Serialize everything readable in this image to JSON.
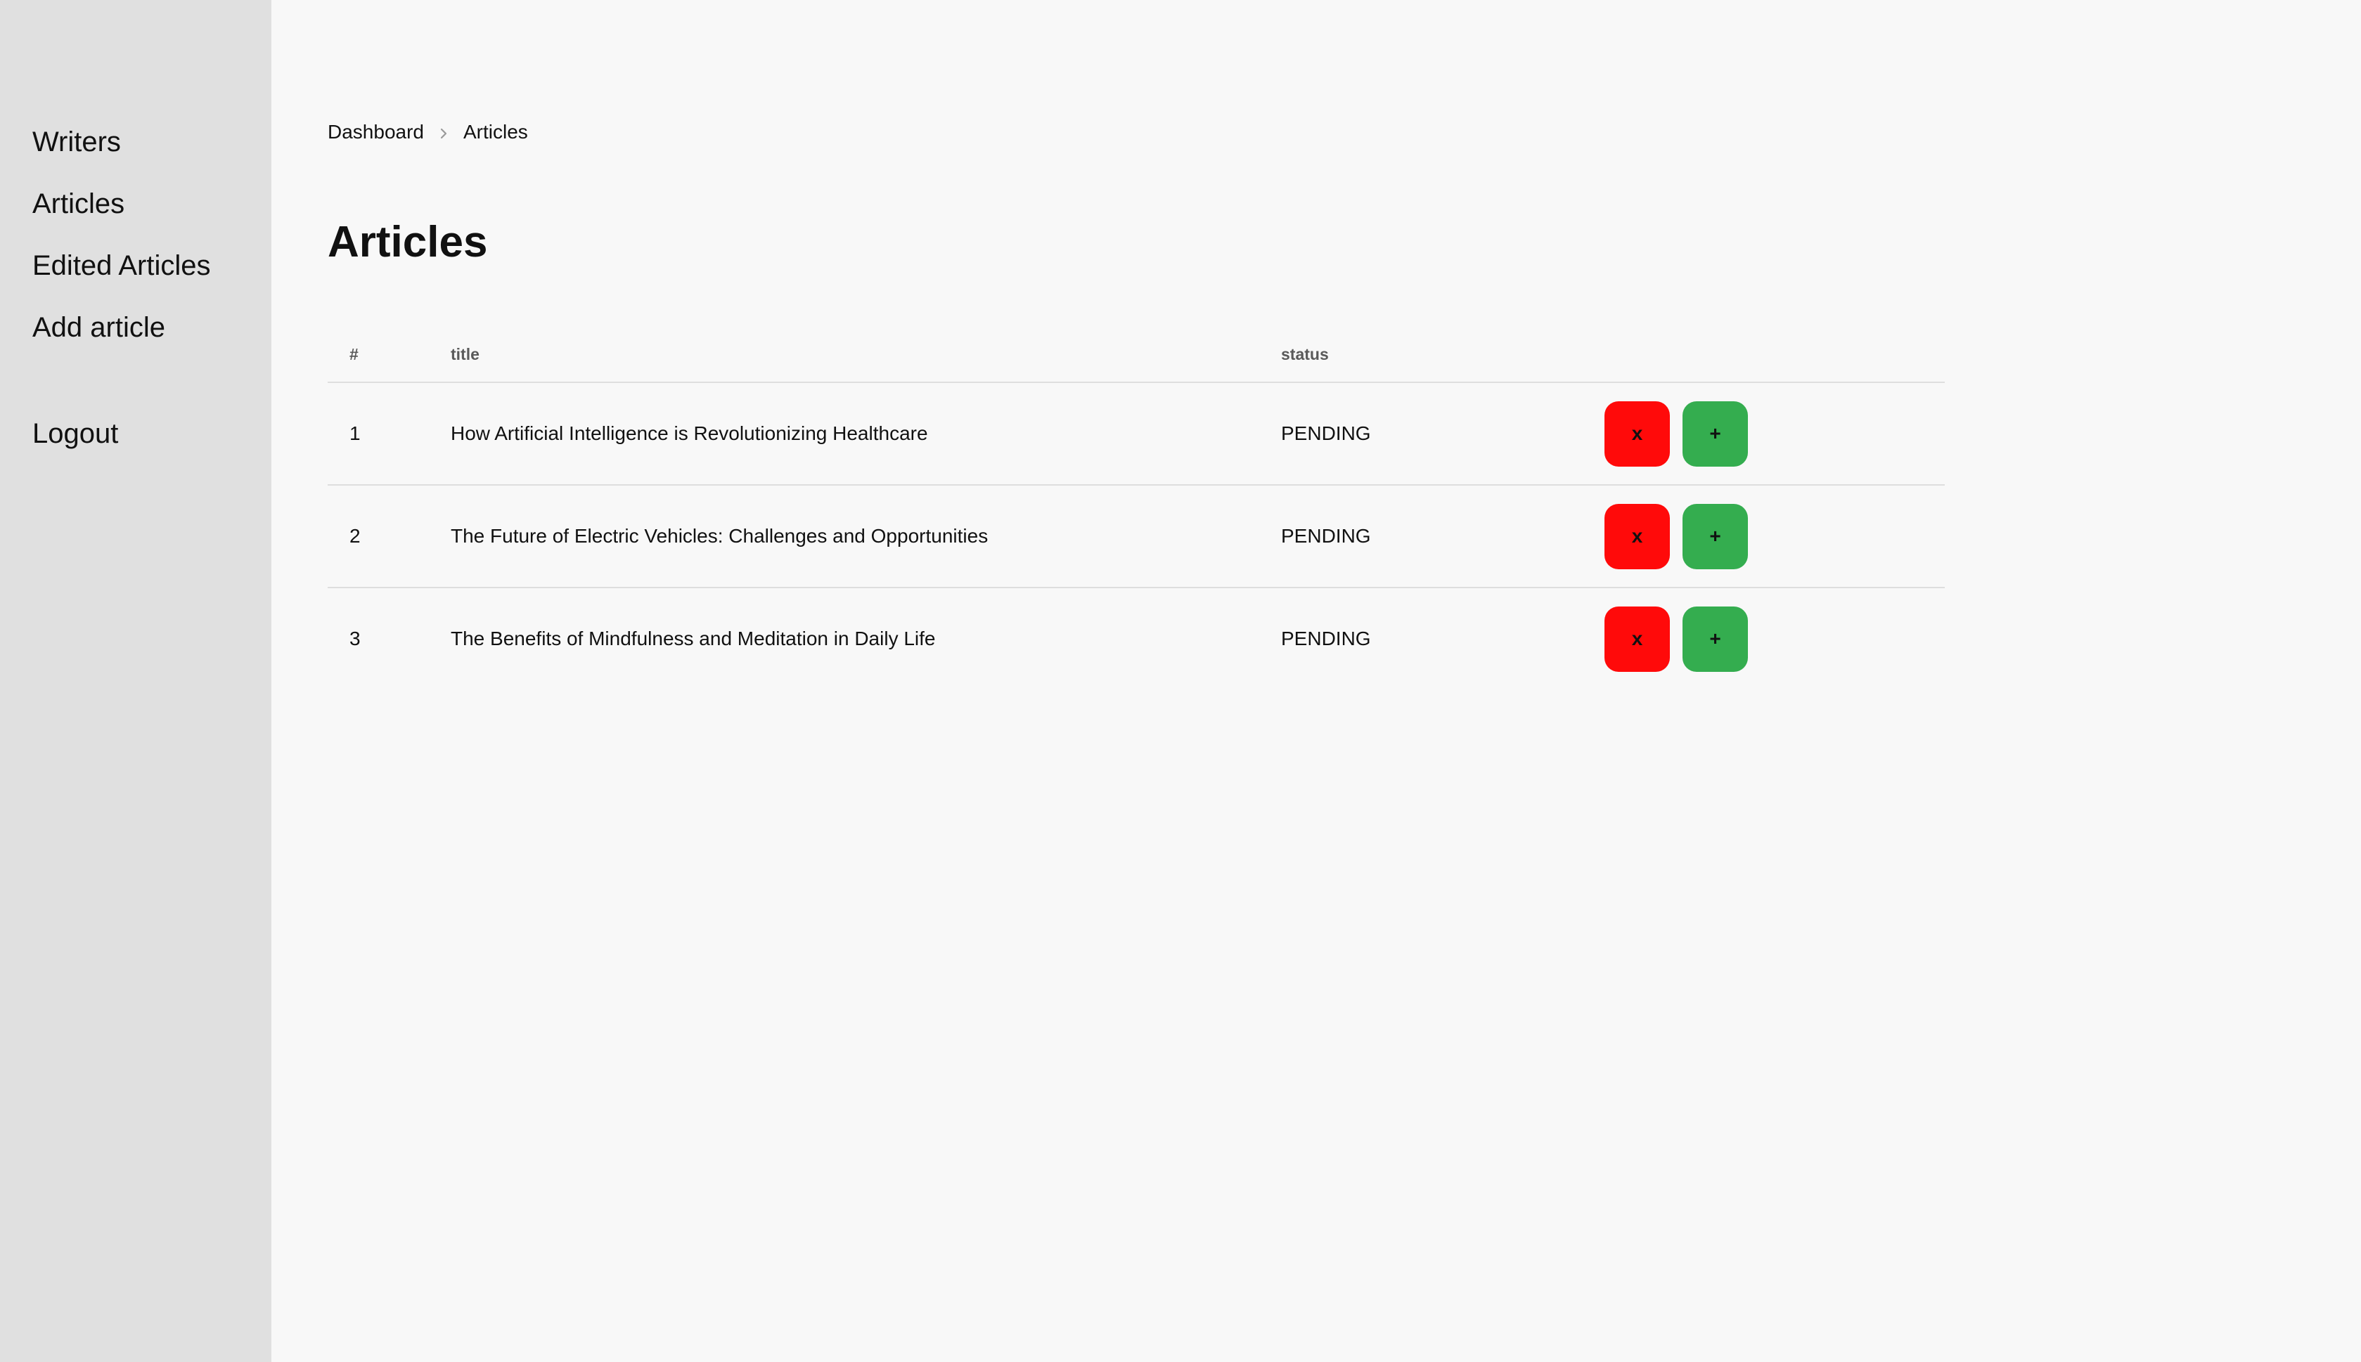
{
  "sidebar": {
    "items": [
      {
        "label": "Writers"
      },
      {
        "label": "Articles"
      },
      {
        "label": "Edited Articles"
      },
      {
        "label": "Add article"
      }
    ],
    "logout_label": "Logout"
  },
  "breadcrumb": {
    "items": [
      "Dashboard",
      "Articles"
    ]
  },
  "page": {
    "title": "Articles"
  },
  "table": {
    "headers": {
      "number": "#",
      "title": "title",
      "status": "status"
    },
    "rows": [
      {
        "number": "1",
        "title": "How Artificial Intelligence is Revolutionizing Healthcare",
        "status": "PENDING",
        "reject_label": "x",
        "approve_label": "+"
      },
      {
        "number": "2",
        "title": "The Future of Electric Vehicles: Challenges and Opportunities",
        "status": "PENDING",
        "reject_label": "x",
        "approve_label": "+"
      },
      {
        "number": "3",
        "title": "The Benefits of Mindfulness and Meditation in Daily Life",
        "status": "PENDING",
        "reject_label": "x",
        "approve_label": "+"
      }
    ]
  },
  "colors": {
    "sidebar_bg": "#e0e0e0",
    "page_bg": "#f8f8f8",
    "reject": "#ff0a0a",
    "approve": "#34ad4f"
  },
  "icons": {
    "breadcrumb_separator": "chevron-right-icon"
  }
}
